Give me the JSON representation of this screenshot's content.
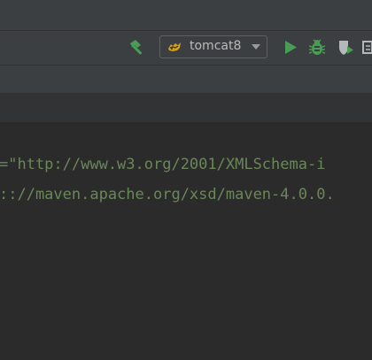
{
  "toolbar": {
    "run_configuration": {
      "label": "tomcat8",
      "icon": "tomcat-icon"
    },
    "icons": [
      "build-hammer-icon",
      "run-icon",
      "debug-icon",
      "run-with-coverage-icon",
      "more-actions-icon"
    ],
    "colors": {
      "build": "#499c54",
      "run": "#499c54",
      "debug": "#499c54",
      "coverage": "#b4b8bb"
    }
  },
  "editor": {
    "lines": [
      "=\"http://www.w3.org/2001/XMLSchema-i",
      ":://maven.apache.org/xsd/maven-4.0.0."
    ],
    "string_color": "#6a8759",
    "background": "#2b2b2b"
  }
}
